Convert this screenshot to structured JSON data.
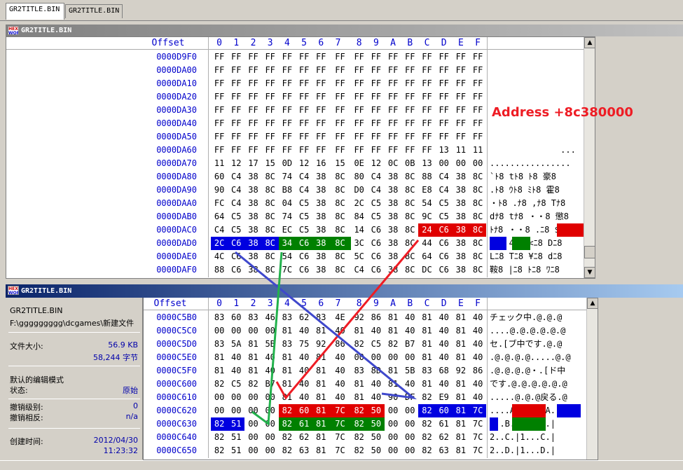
{
  "tabs": [
    {
      "label": "GR2TITLE.BIN"
    },
    {
      "label": "GR2TITLE.BIN"
    }
  ],
  "top_window": {
    "title": "GR2TITLE.BIN",
    "logo": [
      "HEX",
      "WORKS"
    ]
  },
  "bottom_window": {
    "title": "GR2TITLE.BIN",
    "logo": [
      "HEX",
      "WORKS"
    ]
  },
  "header": {
    "offset": "Offset",
    "cols": [
      "0",
      "1",
      "2",
      "3",
      "4",
      "5",
      "6",
      "7",
      "8",
      "9",
      "A",
      "B",
      "C",
      "D",
      "E",
      "F"
    ]
  },
  "top_rows": [
    {
      "offset": "0000D9F0",
      "bytes": [
        "FF",
        "FF",
        "FF",
        "FF",
        "FF",
        "FF",
        "FF",
        "FF",
        "FF",
        "FF",
        "FF",
        "FF",
        "FF",
        "FF",
        "FF",
        "FF"
      ],
      "ascii": ""
    },
    {
      "offset": "0000DA00",
      "bytes": [
        "FF",
        "FF",
        "FF",
        "FF",
        "FF",
        "FF",
        "FF",
        "FF",
        "FF",
        "FF",
        "FF",
        "FF",
        "FF",
        "FF",
        "FF",
        "FF"
      ],
      "ascii": ""
    },
    {
      "offset": "0000DA10",
      "bytes": [
        "FF",
        "FF",
        "FF",
        "FF",
        "FF",
        "FF",
        "FF",
        "FF",
        "FF",
        "FF",
        "FF",
        "FF",
        "FF",
        "FF",
        "FF",
        "FF"
      ],
      "ascii": ""
    },
    {
      "offset": "0000DA20",
      "bytes": [
        "FF",
        "FF",
        "FF",
        "FF",
        "FF",
        "FF",
        "FF",
        "FF",
        "FF",
        "FF",
        "FF",
        "FF",
        "FF",
        "FF",
        "FF",
        "FF"
      ],
      "ascii": ""
    },
    {
      "offset": "0000DA30",
      "bytes": [
        "FF",
        "FF",
        "FF",
        "FF",
        "FF",
        "FF",
        "FF",
        "FF",
        "FF",
        "FF",
        "FF",
        "FF",
        "FF",
        "FF",
        "FF",
        "FF"
      ],
      "ascii": ""
    },
    {
      "offset": "0000DA40",
      "bytes": [
        "FF",
        "FF",
        "FF",
        "FF",
        "FF",
        "FF",
        "FF",
        "FF",
        "FF",
        "FF",
        "FF",
        "FF",
        "FF",
        "FF",
        "FF",
        "FF"
      ],
      "ascii": ""
    },
    {
      "offset": "0000DA50",
      "bytes": [
        "FF",
        "FF",
        "FF",
        "FF",
        "FF",
        "FF",
        "FF",
        "FF",
        "FF",
        "FF",
        "FF",
        "FF",
        "FF",
        "FF",
        "FF",
        "FF"
      ],
      "ascii": ""
    },
    {
      "offset": "0000DA60",
      "bytes": [
        "FF",
        "FF",
        "FF",
        "FF",
        "FF",
        "FF",
        "FF",
        "FF",
        "FF",
        "FF",
        "FF",
        "FF",
        "FF",
        "13",
        "11",
        "11"
      ],
      "ascii": "              ..."
    },
    {
      "offset": "0000DA70",
      "bytes": [
        "11",
        "12",
        "17",
        "15",
        "0D",
        "12",
        "16",
        "15",
        "0E",
        "12",
        "0C",
        "0B",
        "13",
        "00",
        "00",
        "00"
      ],
      "ascii": "................"
    },
    {
      "offset": "0000DA80",
      "bytes": [
        "60",
        "C4",
        "38",
        "8C",
        "74",
        "C4",
        "38",
        "8C",
        "80",
        "C4",
        "38",
        "8C",
        "88",
        "C4",
        "38",
        "8C"
      ],
      "ascii": "`ﾄ8 tﾄ8 ﾄ8 豪8"
    },
    {
      "offset": "0000DA90",
      "bytes": [
        "90",
        "C4",
        "38",
        "8C",
        "B8",
        "C4",
        "38",
        "8C",
        "D0",
        "C4",
        "38",
        "8C",
        "E8",
        "C4",
        "38",
        "8C"
      ],
      "ascii": ".ﾄ8 ｳﾄ8 ﾐﾄ8 霍8"
    },
    {
      "offset": "0000DAA0",
      "bytes": [
        "FC",
        "C4",
        "38",
        "8C",
        "04",
        "C5",
        "38",
        "8C",
        "2C",
        "C5",
        "38",
        "8C",
        "54",
        "C5",
        "38",
        "8C"
      ],
      "ascii": "・ﾄ8 .ﾅ8 ,ﾅ8 Tﾅ8"
    },
    {
      "offset": "0000DAB0",
      "bytes": [
        "64",
        "C5",
        "38",
        "8C",
        "74",
        "C5",
        "38",
        "8C",
        "84",
        "C5",
        "38",
        "8C",
        "9C",
        "C5",
        "38",
        "8C"
      ],
      "ascii": "dﾅ8 tﾅ8 ・・8 懲8"
    },
    {
      "offset": "0000DAC0",
      "bytes": [
        "C4",
        "C5",
        "38",
        "8C",
        "EC",
        "C5",
        "38",
        "8C",
        "14",
        "C6",
        "38",
        "8C",
        "24",
        "C6",
        "38",
        "8C"
      ],
      "ascii": "ﾄﾅ8 ・・8 .ﾆ8 $ﾆ8"
    },
    {
      "offset": "0000DAD0",
      "bytes": [
        "2C",
        "C6",
        "38",
        "8C",
        "34",
        "C6",
        "38",
        "8C",
        "3C",
        "C6",
        "38",
        "8C",
        "44",
        "C6",
        "38",
        "8C"
      ],
      "ascii": ",ﾆ8 4ﾆ8 <ﾆ8 Dﾆ8"
    },
    {
      "offset": "0000DAE0",
      "bytes": [
        "4C",
        "C6",
        "38",
        "8C",
        "54",
        "C6",
        "38",
        "8C",
        "5C",
        "C6",
        "38",
        "8C",
        "64",
        "C6",
        "38",
        "8C"
      ],
      "ascii": "Lﾆ8 Tﾆ8 ¥ﾆ8 dﾆ8"
    },
    {
      "offset": "0000DAF0",
      "bytes": [
        "88",
        "C6",
        "38",
        "8C",
        "7C",
        "C6",
        "38",
        "8C",
        "C4",
        "C6",
        "38",
        "8C",
        "DC",
        "C6",
        "38",
        "8C"
      ],
      "ascii": "鞍8 |ﾆ8 ﾄﾆ8 ﾜﾆ8"
    }
  ],
  "note": "Address +8c380000",
  "info": {
    "filename": "GR2TITLE.BIN",
    "path": "F:\\ggggggggg\\dcgames\\新建文件",
    "size_label": "文件大小:",
    "size_kb": "56.9 KB",
    "size_bytes": "58,244 字节",
    "mode_label": "默认的编辑模式",
    "state_label": "状态:",
    "state_value": "原始",
    "undo_level_label": "撤销级别:",
    "undo_level_value": "0",
    "undo_reverse_label": "撤销相反:",
    "undo_reverse_value": "n/a",
    "created_label": "创建时间:",
    "created_date": "2012/04/30",
    "created_time": "11:23:32"
  },
  "bottom_rows": [
    {
      "offset": "0000C5B0",
      "bytes": [
        "83",
        "60",
        "83",
        "46",
        "83",
        "62",
        "83",
        "4E",
        "92",
        "86",
        "81",
        "40",
        "81",
        "40",
        "81",
        "40"
      ],
      "ascii": "チェック中.@.@.@"
    },
    {
      "offset": "0000C5C0",
      "bytes": [
        "00",
        "00",
        "00",
        "00",
        "81",
        "40",
        "81",
        "40",
        "81",
        "40",
        "81",
        "40",
        "81",
        "40",
        "81",
        "40"
      ],
      "ascii": "....@.@.@.@.@.@"
    },
    {
      "offset": "0000C5D0",
      "bytes": [
        "83",
        "5A",
        "81",
        "5B",
        "83",
        "75",
        "92",
        "86",
        "82",
        "C5",
        "82",
        "B7",
        "81",
        "40",
        "81",
        "40"
      ],
      "ascii": "セ.[ブ中です.@.@"
    },
    {
      "offset": "0000C5E0",
      "bytes": [
        "81",
        "40",
        "81",
        "40",
        "81",
        "40",
        "81",
        "40",
        "00",
        "00",
        "00",
        "00",
        "81",
        "40",
        "81",
        "40"
      ],
      "ascii": ".@.@.@.@.....@.@"
    },
    {
      "offset": "0000C5F0",
      "bytes": [
        "81",
        "40",
        "81",
        "40",
        "81",
        "40",
        "81",
        "40",
        "83",
        "8D",
        "81",
        "5B",
        "83",
        "68",
        "92",
        "86"
      ],
      "ascii": ".@.@.@.@・.[ド中"
    },
    {
      "offset": "0000C600",
      "bytes": [
        "82",
        "C5",
        "82",
        "B7",
        "81",
        "40",
        "81",
        "40",
        "81",
        "40",
        "81",
        "40",
        "81",
        "40",
        "81",
        "40"
      ],
      "ascii": "です.@.@.@.@.@.@"
    },
    {
      "offset": "0000C610",
      "bytes": [
        "00",
        "00",
        "00",
        "00",
        "81",
        "40",
        "81",
        "40",
        "81",
        "40",
        "90",
        "DF",
        "82",
        "E9",
        "81",
        "40"
      ],
      "ascii": ".....@.@.@戻る.@"
    },
    {
      "offset": "0000C620",
      "bytes": [
        "00",
        "00",
        "00",
        "00",
        "82",
        "60",
        "81",
        "7C",
        "82",
        "50",
        "00",
        "00",
        "82",
        "60",
        "81",
        "7C"
      ],
      "ascii": "....A.|1...A.|"
    },
    {
      "offset": "0000C630",
      "bytes": [
        "82",
        "51",
        "00",
        "00",
        "82",
        "61",
        "81",
        "7C",
        "82",
        "50",
        "00",
        "00",
        "82",
        "61",
        "81",
        "7C"
      ],
      "ascii": "2..B.|1...B.|"
    },
    {
      "offset": "0000C640",
      "bytes": [
        "82",
        "51",
        "00",
        "00",
        "82",
        "62",
        "81",
        "7C",
        "82",
        "50",
        "00",
        "00",
        "82",
        "62",
        "81",
        "7C"
      ],
      "ascii": "2..C.|1...C.|"
    },
    {
      "offset": "0000C650",
      "bytes": [
        "82",
        "51",
        "00",
        "00",
        "82",
        "63",
        "81",
        "7C",
        "82",
        "50",
        "00",
        "00",
        "82",
        "63",
        "81",
        "7C"
      ],
      "ascii": "2..D.|1...D.|"
    }
  ],
  "colors": {
    "red": "#e00000",
    "blue": "#0000e0",
    "green": "#008000",
    "arrow_red": "#ee1c24",
    "arrow_blue": "#3f48cc",
    "arrow_green": "#22b14c"
  }
}
